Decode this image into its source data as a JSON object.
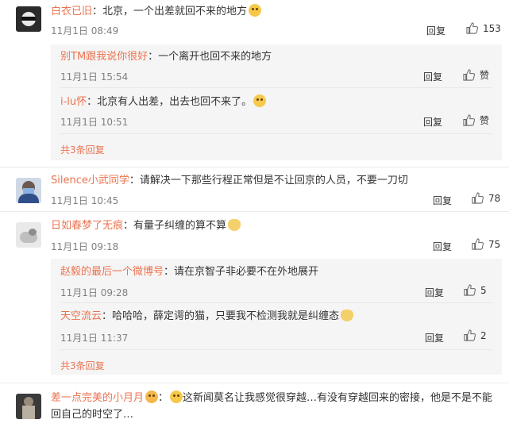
{
  "comments": [
    {
      "user": "白衣已旧",
      "text": "：北京，一个出差就回不来的地方",
      "date": "11月1日 08:49",
      "reply_label": "回复",
      "likes": "153",
      "replies": [
        {
          "user": "别TM跟我说你很好",
          "text": "：一个离开也回不来的地方",
          "date": "11月1日 15:54",
          "reply_label": "回复",
          "likes": "赞"
        },
        {
          "user": "i-lu怀",
          "text": "：北京有人出差，出去也回不来了。",
          "date": "11月1日 10:51",
          "reply_label": "回复",
          "likes": "赞"
        }
      ],
      "more": "共3条回复"
    },
    {
      "user": "Silence小武同学",
      "text": "：请解决一下那些行程正常但是不让回京的人员，不要一刀切",
      "date": "11月1日 10:45",
      "reply_label": "回复",
      "likes": "78"
    },
    {
      "user": "日如春梦了无痕",
      "text": "：有量子纠缠的算不算",
      "date": "11月1日 09:18",
      "reply_label": "回复",
      "likes": "75",
      "replies": [
        {
          "user": "赵毅的最后一个微博号",
          "text": "：请在京智子非必要不在外地展开",
          "date": "11月1日 09:28",
          "reply_label": "回复",
          "likes": "5"
        },
        {
          "user": "天空流云",
          "text": "：哈哈哈，薛定谔的猫，只要我不检测我就是纠缠态",
          "date": "11月1日 11:37",
          "reply_label": "回复",
          "likes": "2"
        }
      ],
      "more": "共3条回复"
    },
    {
      "user": "差一点完美的小月月",
      "text": "这新闻莫名让我感觉很穿越…有没有穿越回来的密接，他是不是不能",
      "text2": "回自己的时空了…"
    }
  ],
  "icons": {
    "like": "thumbs-up-icon",
    "emoji_smile": "smile-emoji-icon",
    "emoji_cat": "cat-emoji-icon",
    "emoji_laugh": "laugh-emoji-icon"
  },
  "colors": {
    "username": "#eb7350",
    "meta": "#808080",
    "sub_bg": "#f5f5f5"
  }
}
